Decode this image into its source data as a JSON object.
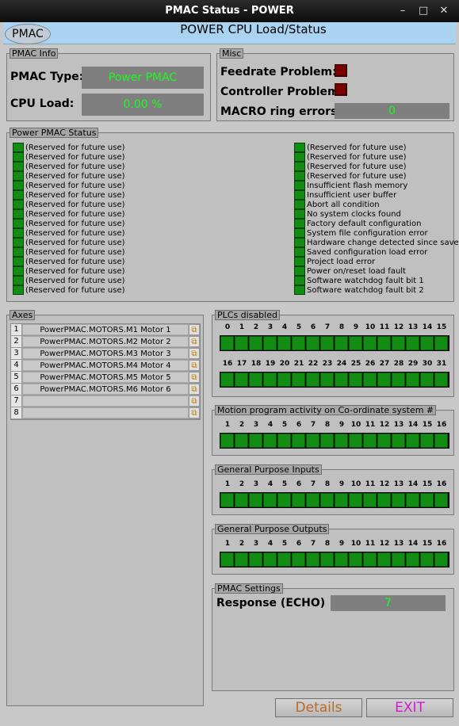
{
  "window": {
    "title": "PMAC Status - POWER",
    "controls": [
      "–",
      "□",
      "✕"
    ]
  },
  "header": {
    "logo": "PMAC",
    "title": "POWER CPU Load/Status"
  },
  "pmac_info": {
    "title": "PMAC Info",
    "type_label": "PMAC Type:",
    "type_value": "Power PMAC",
    "cpu_label": "CPU Load:",
    "cpu_value": "0.00 %"
  },
  "misc": {
    "title": "Misc",
    "feedrate_label": "Feedrate Problem:",
    "controller_label": "Controller Problem:",
    "macro_label": "MACRO ring errors:",
    "macro_value": "0"
  },
  "status": {
    "title": "Power PMAC Status",
    "left": [
      "(Reserved for future use)",
      "(Reserved for future use)",
      "(Reserved for future use)",
      "(Reserved for future use)",
      "(Reserved for future use)",
      "(Reserved for future use)",
      "(Reserved for future use)",
      "(Reserved for future use)",
      "(Reserved for future use)",
      "(Reserved for future use)",
      "(Reserved for future use)",
      "(Reserved for future use)",
      "(Reserved for future use)",
      "(Reserved for future use)",
      "(Reserved for future use)",
      "(Reserved for future use)"
    ],
    "right": [
      "(Reserved for future use)",
      "(Reserved for future use)",
      "(Reserved for future use)",
      "(Reserved for future use)",
      "Insufficient flash memory",
      "Insufficient user buffer",
      "Abort all condition",
      "No system clocks found",
      "Factory default configuration",
      "System file configuration error",
      "Hardware change detected since save",
      "Saved configuration load error",
      "Project load error",
      "Power on/reset load fault",
      "Software watchdog fault bit 1",
      "Software watchdog fault bit 2"
    ]
  },
  "axes": {
    "title": "Axes",
    "rows": [
      {
        "idx": "1",
        "name": "PowerPMAC.MOTORS.M1 Motor 1"
      },
      {
        "idx": "2",
        "name": "PowerPMAC.MOTORS.M2 Motor 2"
      },
      {
        "idx": "3",
        "name": "PowerPMAC.MOTORS.M3 Motor 3"
      },
      {
        "idx": "4",
        "name": "PowerPMAC.MOTORS.M4 Motor 4"
      },
      {
        "idx": "5",
        "name": "PowerPMAC.MOTORS.M5 Motor 5"
      },
      {
        "idx": "6",
        "name": "PowerPMAC.MOTORS.M6 Motor 6"
      },
      {
        "idx": "7",
        "name": ""
      },
      {
        "idx": "8",
        "name": ""
      }
    ]
  },
  "plcs": {
    "title": "PLCs disabled",
    "row1": [
      "0",
      "1",
      "2",
      "3",
      "4",
      "5",
      "6",
      "7",
      "8",
      "9",
      "10",
      "11",
      "12",
      "13",
      "14",
      "15"
    ],
    "row2": [
      "16",
      "17",
      "18",
      "19",
      "20",
      "21",
      "22",
      "23",
      "24",
      "25",
      "26",
      "27",
      "28",
      "29",
      "30",
      "31"
    ]
  },
  "motion": {
    "title": "Motion program activity on Co-ordinate system #",
    "nums": [
      "1",
      "2",
      "3",
      "4",
      "5",
      "6",
      "7",
      "8",
      "9",
      "10",
      "11",
      "12",
      "13",
      "14",
      "15",
      "16"
    ]
  },
  "inputs": {
    "title": "General Purpose Inputs",
    "nums": [
      "1",
      "2",
      "3",
      "4",
      "5",
      "6",
      "7",
      "8",
      "9",
      "10",
      "11",
      "12",
      "13",
      "14",
      "15",
      "16"
    ]
  },
  "outputs": {
    "title": "General Purpose Outputs",
    "nums": [
      "1",
      "2",
      "3",
      "4",
      "5",
      "6",
      "7",
      "8",
      "9",
      "10",
      "11",
      "12",
      "13",
      "14",
      "15",
      "16"
    ]
  },
  "settings": {
    "title": "PMAC Settings",
    "response_label": "Response (ECHO)",
    "response_value": "7"
  },
  "buttons": {
    "details": "Details",
    "exit": "EXIT"
  },
  "colors": {
    "led_green": "#138c13",
    "led_red": "#7a0000",
    "value_text": "#1cfa1c",
    "header_bg": "#a9d3f0",
    "details_text": "#b86a26",
    "exit_text": "#d21bd2"
  }
}
